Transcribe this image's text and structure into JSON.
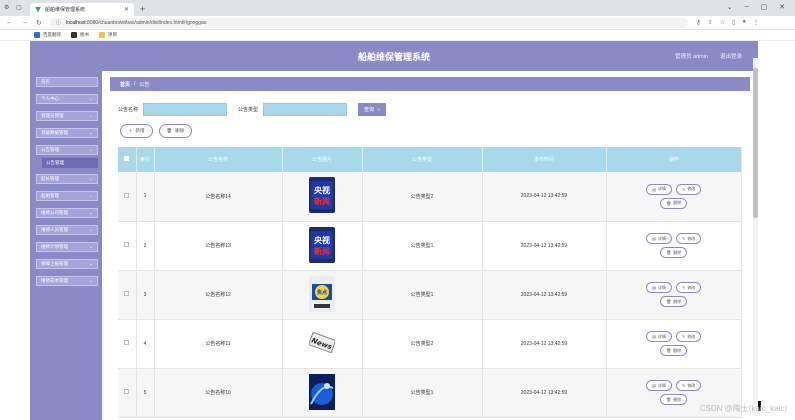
{
  "browser": {
    "tab_title": "船舶维保管理系统",
    "url_prefix": "localhost",
    "url_rest": ":8080/chuanboweibao/admin/dist/index.html#/gonggao",
    "bookmarks": [
      {
        "label": "百度翻译",
        "color": "#2f6fdd"
      },
      {
        "label": "图书",
        "color": "#333333"
      },
      {
        "label": "项目",
        "color": "#f2c14e"
      }
    ]
  },
  "header": {
    "system_title": "船舶维保管理系统",
    "admin_label": "管理员 admin",
    "logout_label": "退出登录"
  },
  "sidebar": {
    "items": [
      {
        "label": "首页",
        "chevron": false
      },
      {
        "label": "个人中心",
        "chevron": true
      },
      {
        "label": "管理员管理",
        "chevron": true
      },
      {
        "label": "基础数据管理",
        "chevron": true
      },
      {
        "label": "公告管理",
        "chevron": true
      },
      {
        "label": "船长管理",
        "chevron": true
      },
      {
        "label": "船舶管理",
        "chevron": true
      },
      {
        "label": "维修公司管理",
        "chevron": true
      },
      {
        "label": "维修人员管理",
        "chevron": true
      },
      {
        "label": "维修计划管理",
        "chevron": true
      },
      {
        "label": "保障上报管理",
        "chevron": true
      },
      {
        "label": "维修成本管理",
        "chevron": true
      }
    ],
    "active_sub": "公告管理"
  },
  "breadcrumb": {
    "home": "首页",
    "sep": "/",
    "current": "公告"
  },
  "search": {
    "name_label": "公告名称",
    "type_label": "公告类型",
    "button_label": "查询"
  },
  "actions": {
    "add_label": "新增",
    "delete_label": "删除"
  },
  "table": {
    "headers": [
      "索引",
      "公告名称",
      "公告图片",
      "公告类型",
      "发布时间",
      "操作"
    ],
    "op_labels": {
      "detail": "详情",
      "edit": "修改",
      "delete": "删除"
    },
    "rows": [
      {
        "index": "1",
        "name": "公告名称14",
        "type": "公告类型2",
        "time": "2023-04-12 13:42:59",
        "img": "cctv"
      },
      {
        "index": "2",
        "name": "公告名称13",
        "type": "公告类型1",
        "time": "2023-04-12 13:42:59",
        "img": "cctv"
      },
      {
        "index": "3",
        "name": "公告名称12",
        "type": "公告类型1",
        "time": "2023-04-12 13:42:59",
        "img": "focus"
      },
      {
        "index": "4",
        "name": "公告名称11",
        "type": "公告类型2",
        "time": "2023-04-12 13:42:59",
        "img": "news"
      },
      {
        "index": "5",
        "name": "公告名称10",
        "type": "公告类型1",
        "time": "2023-04-12 13:42:59",
        "img": "blue"
      }
    ]
  },
  "watermark": "CSDN @陶士(kaic_kaic)"
}
